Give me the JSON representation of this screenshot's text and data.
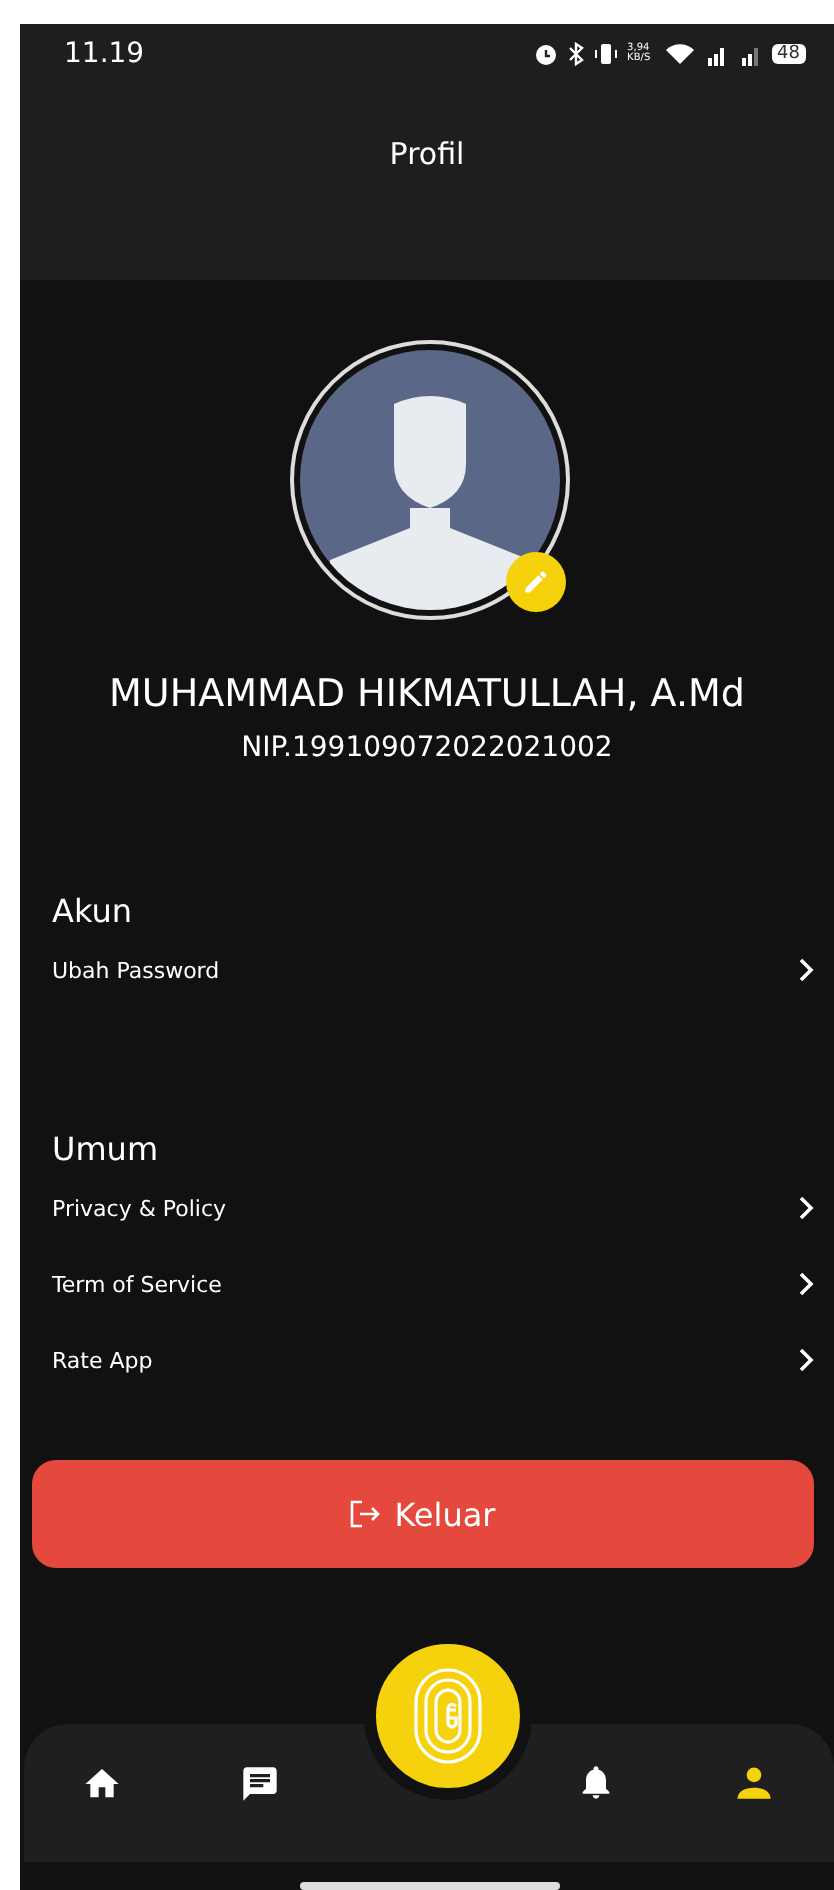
{
  "status_bar": {
    "time": "11.19",
    "speed": "3,94 KB/S",
    "battery": "48"
  },
  "header": {
    "title": "Profil"
  },
  "profile": {
    "name": "MUHAMMAD HIKMATULLAH, A.Md",
    "nip": "NIP.199109072022021002"
  },
  "sections": [
    {
      "title": "Akun",
      "items": [
        {
          "label": "Ubah Password"
        }
      ]
    },
    {
      "title": "Umum",
      "items": [
        {
          "label": "Privacy & Policy"
        },
        {
          "label": "Term of Service"
        },
        {
          "label": "Rate App"
        }
      ]
    }
  ],
  "logout": {
    "label": "Keluar"
  },
  "nav": [
    {
      "kind": "home",
      "selected": false
    },
    {
      "kind": "messages",
      "selected": false
    },
    {
      "kind": "bell",
      "selected": false
    },
    {
      "kind": "profile",
      "selected": true
    }
  ]
}
